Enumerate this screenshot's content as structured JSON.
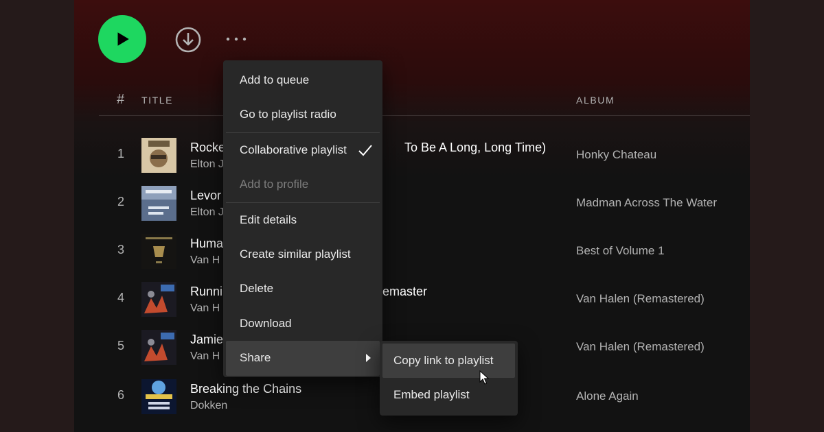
{
  "controls": {
    "play_icon": "play-icon",
    "download_icon": "download-icon",
    "more_icon": "more-options-icon",
    "accent": "#1ed760"
  },
  "table": {
    "headers": {
      "index": "#",
      "title": "TITLE",
      "album": "ALBUM"
    },
    "rows": [
      {
        "index": "1",
        "title": "Rocke",
        "title_tail": "To Be A Long, Long Time)",
        "artist": "Elton J",
        "album": "Honky Chateau"
      },
      {
        "index": "2",
        "title": "Levor",
        "title_tail": "",
        "artist": "Elton J",
        "album": "Madman Across The Water"
      },
      {
        "index": "3",
        "title": "Huma",
        "title_tail": "",
        "artist": "Van H",
        "album": "Best of Volume 1"
      },
      {
        "index": "4",
        "title": "Runni",
        "title_tail": "emaster",
        "artist": "Van H",
        "album": "Van Halen (Remastered)"
      },
      {
        "index": "5",
        "title": "Jamie",
        "title_tail": "",
        "artist": "Van H",
        "album": "Van Halen (Remastered)"
      },
      {
        "index": "6",
        "title": "Breaking the Chains",
        "title_tail": "",
        "artist": "Dokken",
        "album": "Alone Again"
      }
    ]
  },
  "context_menu": {
    "items": [
      {
        "label": "Add to queue"
      },
      {
        "label": "Go to playlist radio"
      },
      {
        "label": "Collaborative playlist",
        "checked": true
      },
      {
        "label": "Add to profile",
        "disabled": true
      },
      {
        "label": "Edit details"
      },
      {
        "label": "Create similar playlist"
      },
      {
        "label": "Delete"
      },
      {
        "label": "Download"
      },
      {
        "label": "Share",
        "has_submenu": true
      }
    ]
  },
  "share_submenu": {
    "items": [
      {
        "label": "Copy link to playlist"
      },
      {
        "label": "Embed playlist"
      }
    ]
  }
}
